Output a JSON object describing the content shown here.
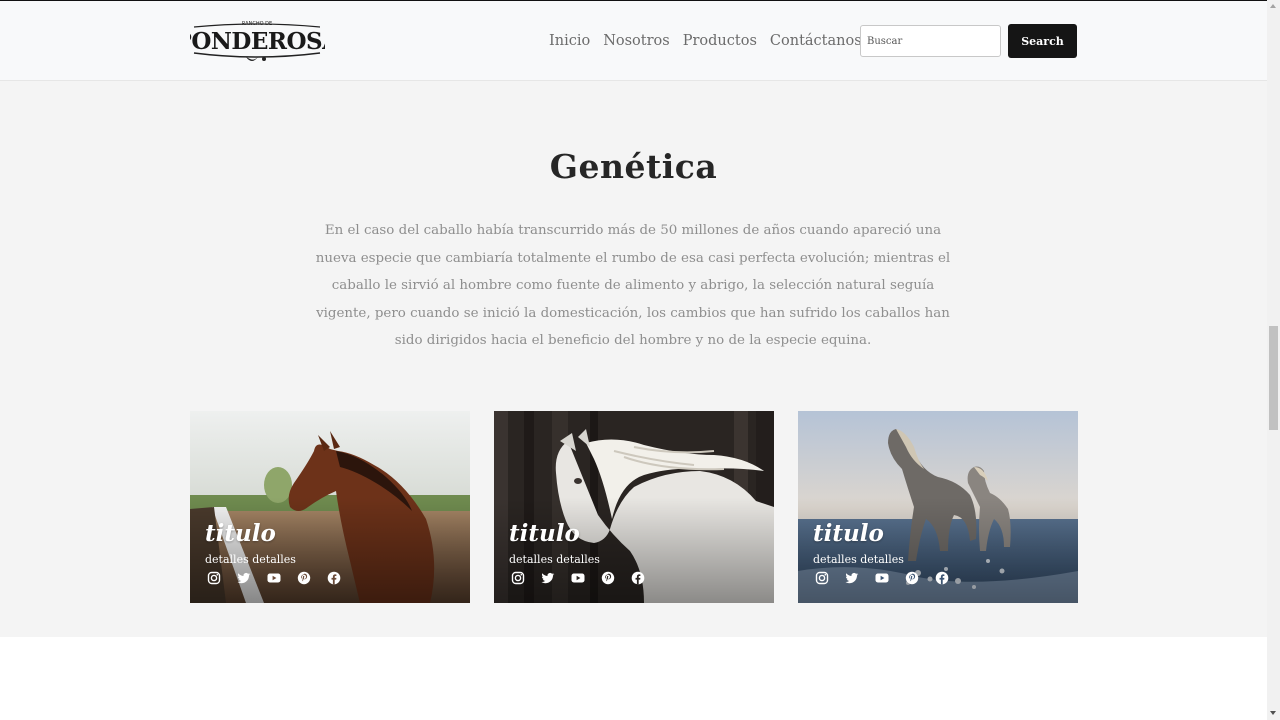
{
  "header": {
    "logo_text": "PONDEROSA",
    "logo_small_text": "RANCHO DE",
    "nav": [
      "Inicio",
      "Nosotros",
      "Productos",
      "Contáctanos"
    ],
    "search_placeholder": "Buscar",
    "search_button": "Search"
  },
  "main": {
    "title": "Genética",
    "paragraph": "En el caso del caballo había transcurrido más de 50 millones de años cuando apareció una nueva especie que cambiaría totalmente el rumbo de esa casi perfecta evolución; mientras el caballo le sirvió al hombre como fuente de alimento y abrigo, la selección natural seguía vigente, pero cuando se inició la domesticación, los cambios que han sufrido los caballos han sido dirigidos hacia el beneficio del hombre y no de la especie equina.",
    "cards": [
      {
        "title": "titulo",
        "details": "detalles detalles"
      },
      {
        "title": "titulo",
        "details": "detalles detalles"
      },
      {
        "title": "titulo",
        "details": "detalles detalles"
      }
    ],
    "social_icons": [
      "instagram-icon",
      "twitter-icon",
      "youtube-icon",
      "pinterest-icon",
      "facebook-icon"
    ]
  },
  "colors": {
    "navbar_bg": "#f8f9fa",
    "section_bg": "#f4f4f4",
    "button_bg": "#151515",
    "paragraph_text": "#8e8e8e"
  }
}
